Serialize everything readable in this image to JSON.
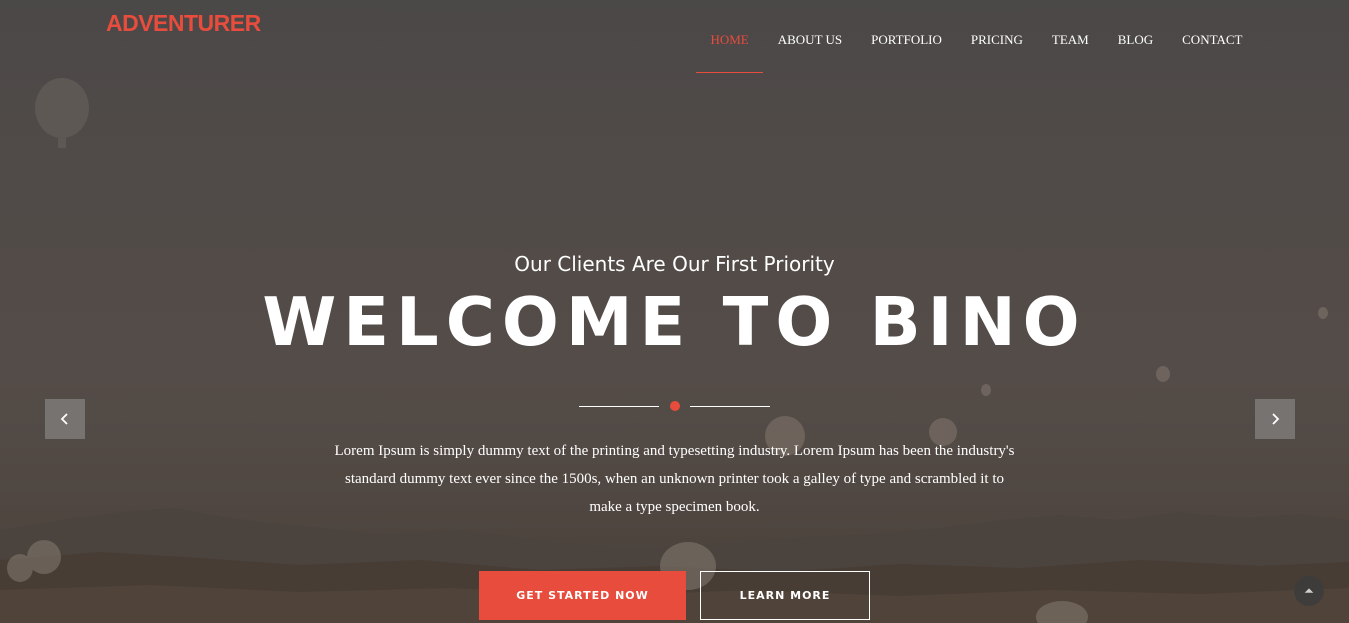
{
  "colors": {
    "accent": "#e74c3c",
    "text": "#ffffff",
    "overlay": "#55504c"
  },
  "header": {
    "logo": "ADVENTURER",
    "nav": [
      {
        "label": "HOME",
        "active": true
      },
      {
        "label": "ABOUT US",
        "active": false
      },
      {
        "label": "PORTFOLIO",
        "active": false
      },
      {
        "label": "PRICING",
        "active": false
      },
      {
        "label": "TEAM",
        "active": false
      },
      {
        "label": "BLOG",
        "active": false
      },
      {
        "label": "CONTACT",
        "active": false
      }
    ]
  },
  "hero": {
    "subtitle": "Our Clients Are Our First Priority",
    "title": "WELCOME TO BINO",
    "description": "Lorem Ipsum is simply dummy text of the printing and typesetting industry. Lorem Ipsum has been the industry's standard dummy text ever since the 1500s, when an unknown printer took a galley of type and scrambled it to make a type specimen book.",
    "primary_button": "GET STARTED NOW",
    "secondary_button": "LEARN MORE"
  },
  "controls": {
    "prev_icon": "chevron-left-icon",
    "next_icon": "chevron-right-icon",
    "scroll_top_icon": "chevron-up-icon"
  }
}
